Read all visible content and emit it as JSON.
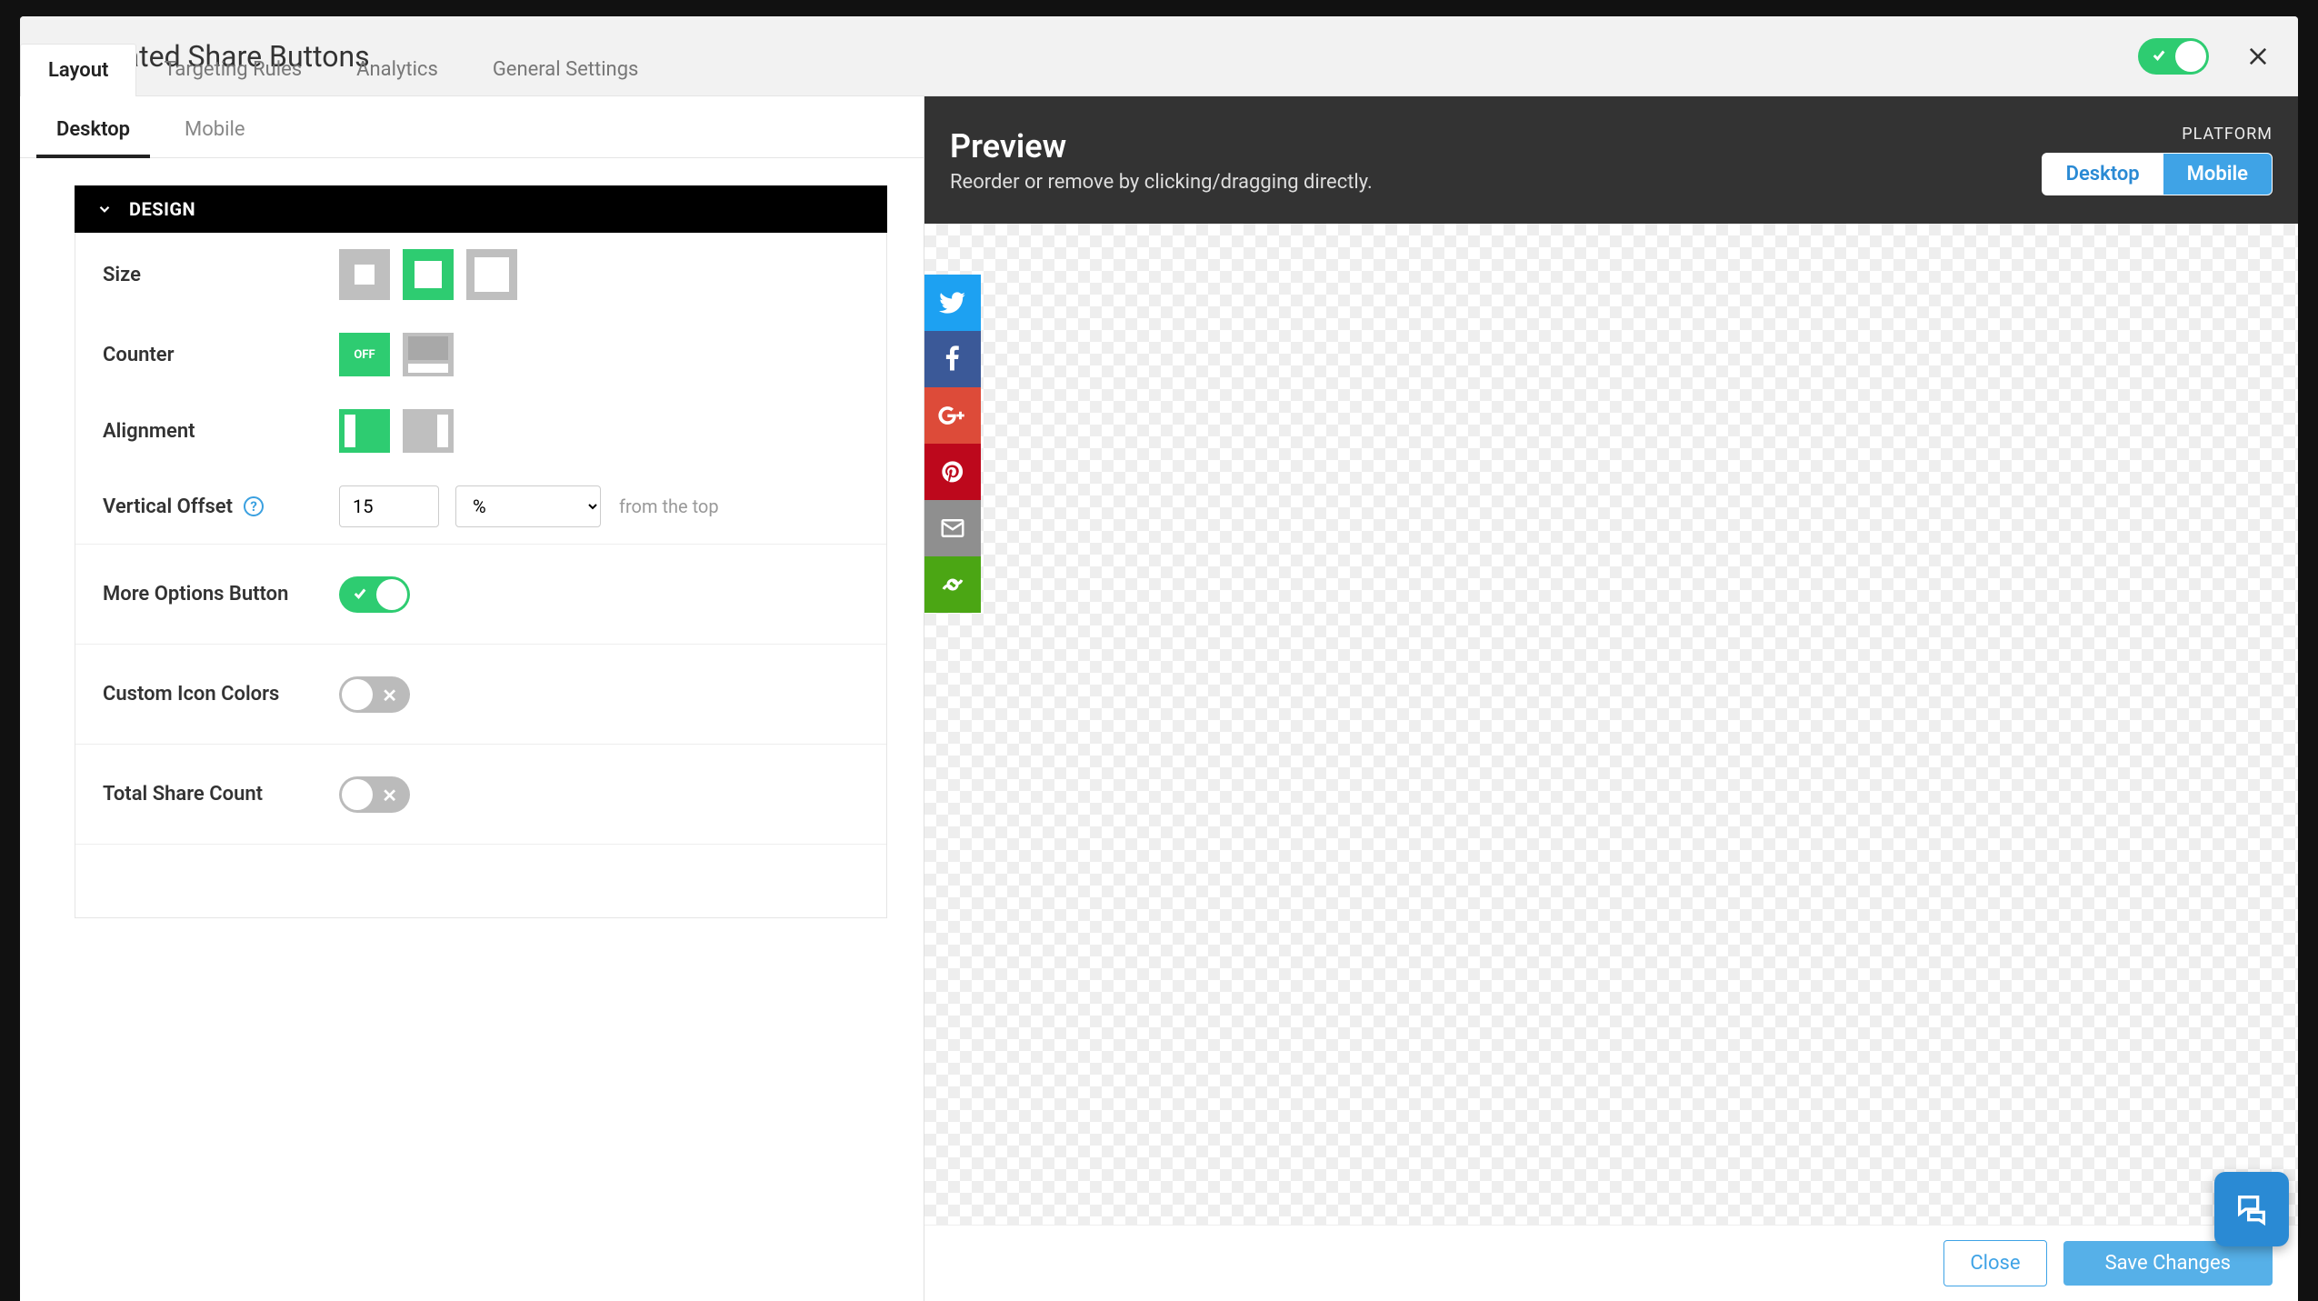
{
  "header": {
    "title": "Floated Share Buttons"
  },
  "tabs": {
    "layout": "Layout",
    "targeting": "Targeting Rules",
    "analytics": "Analytics",
    "general": "General Settings"
  },
  "deviceTabs": {
    "desktop": "Desktop",
    "mobile": "Mobile"
  },
  "design": {
    "section_label": "DESIGN",
    "size_label": "Size",
    "counter_label": "Counter",
    "counter_off_text": "OFF",
    "alignment_label": "Alignment",
    "voff_label": "Vertical Offset",
    "voff_value": "15",
    "voff_unit": "%",
    "voff_hint": "from the top",
    "more_options_label": "More Options Button",
    "custom_colors_label": "Custom Icon Colors",
    "total_share_label": "Total Share Count"
  },
  "preview": {
    "title": "Preview",
    "subtitle": "Reorder or remove by clicking/dragging directly.",
    "platform_label": "PLATFORM",
    "desktop_btn": "Desktop",
    "mobile_btn": "Mobile"
  },
  "footer": {
    "close": "Close",
    "save": "Save Changes"
  }
}
